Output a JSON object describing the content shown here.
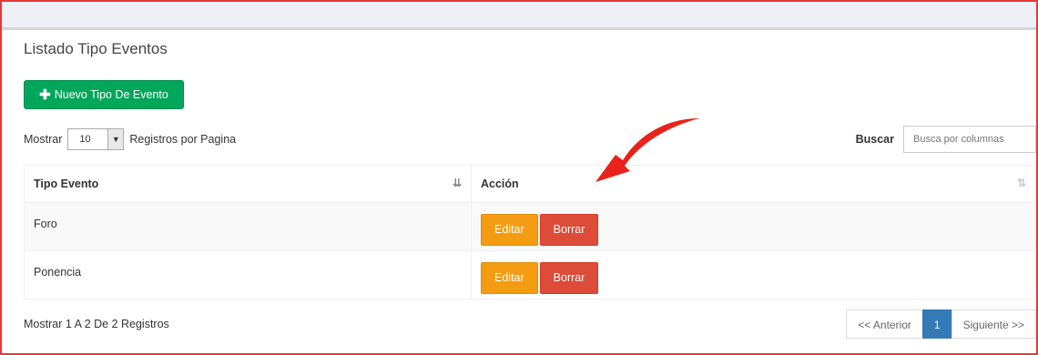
{
  "page": {
    "title": "Listado Tipo Eventos",
    "new_button": "Nuevo Tipo De Evento",
    "new_button_icon": "plus-icon"
  },
  "controls": {
    "show_label": "Mostrar",
    "page_length": "10",
    "per_page_label": "Registros por Pagina",
    "search_label": "Buscar",
    "search_placeholder": "Busca por columnas"
  },
  "table": {
    "headers": [
      "Tipo Evento",
      "Acción"
    ],
    "rows": [
      {
        "tipo": "Foro",
        "edit": "Editar",
        "delete": "Borrar"
      },
      {
        "tipo": "Ponencia",
        "edit": "Editar",
        "delete": "Borrar"
      }
    ]
  },
  "footer": {
    "info": "Mostrar 1 A 2 De 2 Registros",
    "prev": "<< Anterior",
    "current_page": "1",
    "next": "Siguiente >>"
  },
  "colors": {
    "accent_green": "#00a65a",
    "edit_orange": "#f39c12",
    "delete_red": "#dd4b39",
    "page_active": "#337ab7",
    "annotation_red": "#e53935"
  }
}
